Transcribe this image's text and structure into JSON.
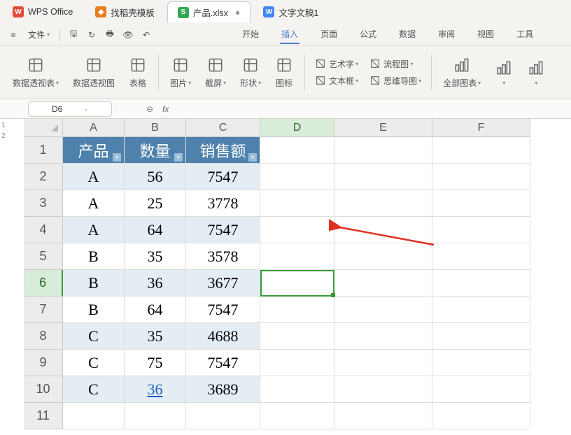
{
  "tabs": [
    {
      "icon_bg": "#e34d3a",
      "icon_text": "W",
      "label": "WPS Office"
    },
    {
      "icon_bg": "#e67e22",
      "icon_text": "◆",
      "label": "找稻壳模板"
    },
    {
      "icon_bg": "#34a853",
      "icon_text": "S",
      "label": "产品.xlsx",
      "active": true,
      "dirty": "●"
    },
    {
      "icon_bg": "#4285f4",
      "icon_text": "W",
      "label": "文字文稿1"
    }
  ],
  "menu": {
    "file": "文件",
    "tabs": [
      "开始",
      "插入",
      "页面",
      "公式",
      "数据",
      "审阅",
      "视图",
      "工具"
    ],
    "active_idx": 1
  },
  "ribbon": [
    {
      "label": "数据透视表",
      "dd": true
    },
    {
      "label": "数据透视图",
      "dd": false
    },
    {
      "label": "表格",
      "dd": false
    },
    {
      "sep": true
    },
    {
      "label": "图片",
      "dd": true
    },
    {
      "label": "截屏",
      "dd": true
    },
    {
      "label": "形状",
      "dd": true
    },
    {
      "label": "图标",
      "dd": false
    },
    {
      "sep": true
    },
    {
      "label": "艺术字",
      "dd": true,
      "compact": true,
      "compact_label2": "文本框",
      "compact2_dd": true
    },
    {
      "label": "流程图",
      "dd": true,
      "compact": true,
      "compact_label2": "思维导图",
      "compact2_dd": true
    },
    {
      "sep": true
    },
    {
      "label": "全部图表",
      "dd": true
    },
    {
      "label": "",
      "dd": true,
      "iconOnly": true
    },
    {
      "label": "",
      "dd": true,
      "iconOnly": true
    }
  ],
  "namebox": {
    "value": "D6"
  },
  "fx": {
    "label": "fx"
  },
  "side_tabs": [
    "1",
    "2"
  ],
  "columns": [
    {
      "name": "A",
      "w": 88
    },
    {
      "name": "B",
      "w": 88
    },
    {
      "name": "C",
      "w": 106
    },
    {
      "name": "D",
      "w": 106,
      "sel": true
    },
    {
      "name": "E",
      "w": 140
    },
    {
      "name": "F",
      "w": 140
    }
  ],
  "rows": [
    "1",
    "2",
    "3",
    "4",
    "5",
    "6",
    "7",
    "8",
    "9",
    "10",
    "11"
  ],
  "sel_row_idx": 5,
  "table": {
    "headers": [
      "产品",
      "数量",
      "销售额"
    ],
    "data": [
      {
        "p": "A",
        "q": "56",
        "s": "7547",
        "band": true
      },
      {
        "p": "A",
        "q": "25",
        "s": "3778",
        "band": false
      },
      {
        "p": "A",
        "q": "64",
        "s": "7547",
        "band": true
      },
      {
        "p": "B",
        "q": "35",
        "s": "3578",
        "band": false
      },
      {
        "p": "B",
        "q": "36",
        "s": "3677",
        "band": true
      },
      {
        "p": "B",
        "q": "64",
        "s": "7547",
        "band": false
      },
      {
        "p": "C",
        "q": "35",
        "s": "4688",
        "band": true
      },
      {
        "p": "C",
        "q": "75",
        "s": "7547",
        "band": false
      },
      {
        "p": "C",
        "q": "36",
        "s": "3689",
        "band": true,
        "q_link": true
      }
    ]
  },
  "selected_cell": {
    "col_idx": 3,
    "row_idx": 5
  }
}
